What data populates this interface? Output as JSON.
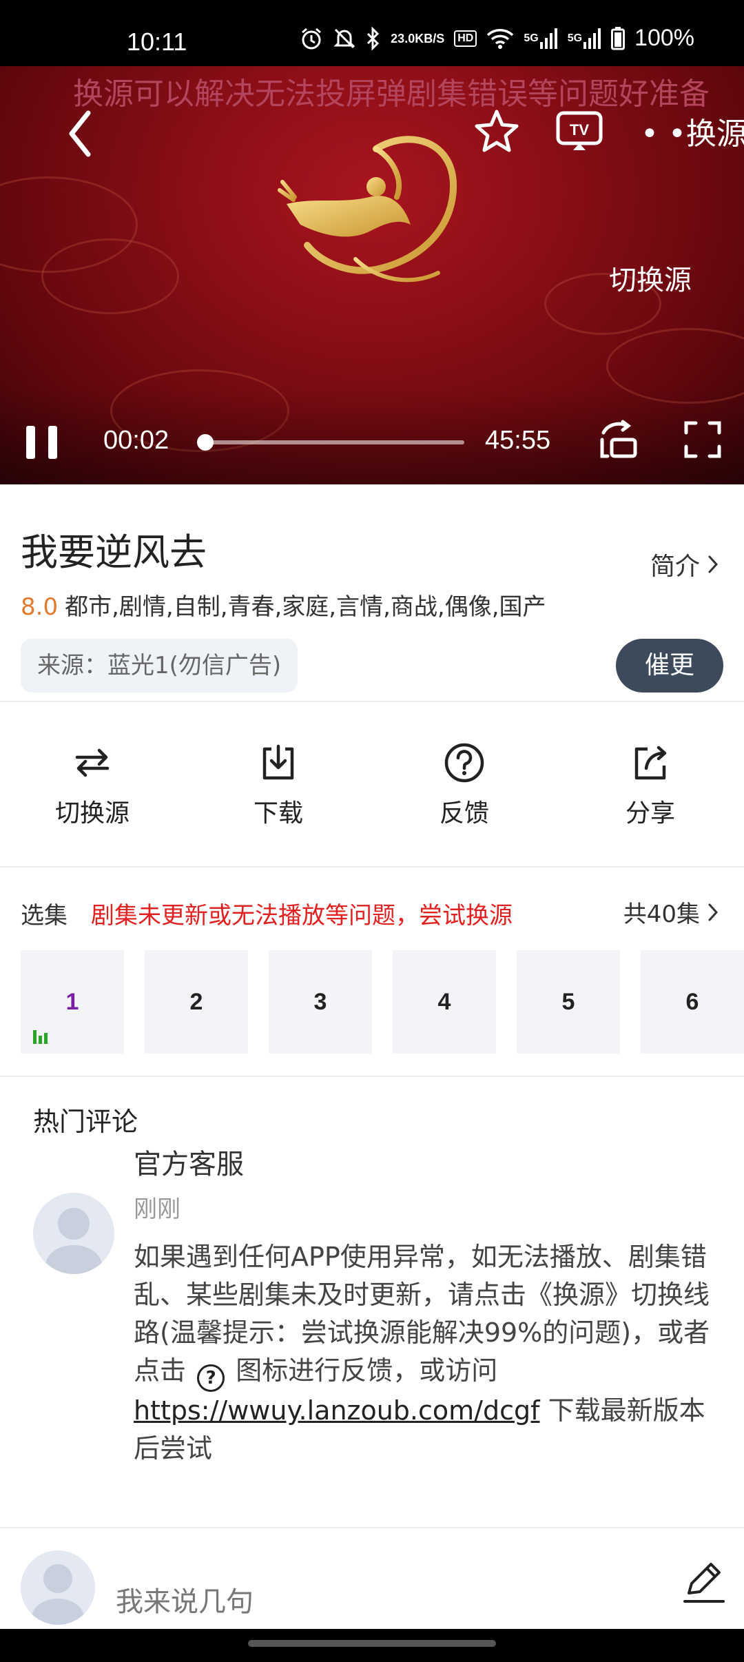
{
  "status_bar": {
    "time": "10:11",
    "speed_value": "23.0",
    "speed_unit": "KB/S",
    "hd_badge": "HD",
    "net_5g_a": "5G",
    "net_5g_b": "5G",
    "battery": "100%"
  },
  "player": {
    "marquee_text": "换源可以解决无法投屏弹剧集错误等问题好准备",
    "more_text": "换源可",
    "switch_source_label": "切换源",
    "current_time": "00:02",
    "total_time": "45:55",
    "progress_fraction": 0.0007
  },
  "show": {
    "title": "我要逆风去",
    "intro_label": "简介",
    "score": "8.0",
    "tags": "都市,剧情,自制,青春,家庭,言情,商战,偶像,国产",
    "source_label": "来源：蓝光1(勿信广告)",
    "urge_button": "催更"
  },
  "actions": [
    {
      "label": "切换源",
      "icon": "switch-icon"
    },
    {
      "label": "下载",
      "icon": "download-icon"
    },
    {
      "label": "反馈",
      "icon": "help-icon"
    },
    {
      "label": "分享",
      "icon": "share-icon"
    }
  ],
  "episodes": {
    "header": "选集",
    "warning": "剧集未更新或无法播放等问题，尝试换源",
    "total_label": "共40集",
    "items": [
      "1",
      "2",
      "3",
      "4",
      "5",
      "6"
    ],
    "active_index": 0
  },
  "comments": {
    "header": "热门评论",
    "items": [
      {
        "user": "官方客服",
        "time": "刚刚",
        "text_1": "如果遇到任何APP使用异常，如无法播放、剧集错乱、某些剧集未及时更新，请点击《换源》切换线路(温馨提示：尝试换源能解决99%的问题)，或者点击",
        "icon_glyph": "?",
        "text_2": "图标进行反馈，或访问",
        "link": "https://wwuy.lanzoub.com/dcgf",
        "text_3": "下载最新版本后尝试"
      }
    ]
  },
  "bottom_bar": {
    "placeholder": "我来说几句"
  },
  "colors": {
    "accent_score": "#e07a2e",
    "warning_red": "#e22020",
    "urge_bg": "#3c4a5c",
    "active_episode": "#7a1ea8",
    "playing_bars": "#2aa52a"
  }
}
